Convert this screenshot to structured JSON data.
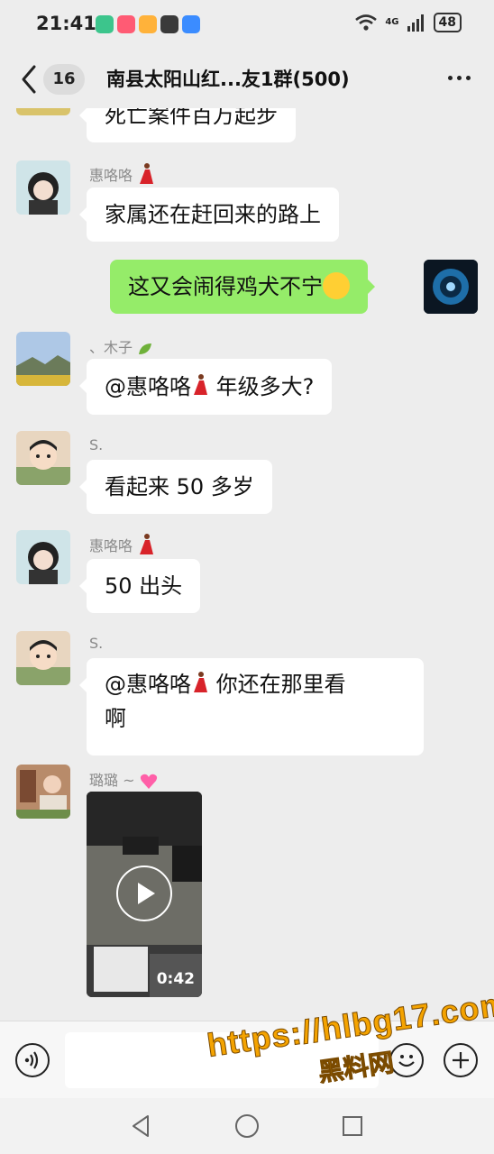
{
  "status_bar": {
    "time": "21:41",
    "network": "4G",
    "battery": "48"
  },
  "header": {
    "unread_count": "16",
    "title": "南县太阳山红...友1群(500)"
  },
  "messages": [
    {
      "text": "死亡案件百万起步"
    },
    {
      "sender": "惠咯咯",
      "text": "家属还在赶回来的路上"
    },
    {
      "text": "这又会闹得鸡犬不宁"
    },
    {
      "sender": "、木子",
      "text_prefix": "@惠咯咯",
      "text": " 年级多大?"
    },
    {
      "sender": "S.",
      "text": "看起来 50 多岁"
    },
    {
      "sender": "惠咯咯",
      "text": "50 出头"
    },
    {
      "sender": "S.",
      "text_prefix": "@惠咯咯",
      "text_line1": " 你还在那里看",
      "text_line2": "啊"
    },
    {
      "sender": "璐璐 ~",
      "video_duration": "0:42"
    }
  ],
  "input": {
    "placeholder": ""
  },
  "watermark": {
    "url": "https://hlbg17.com",
    "name": "黑料网"
  },
  "colors": {
    "background": "#ededed",
    "self_bubble": "#95ec69",
    "other_bubble": "#ffffff"
  },
  "icons": [
    "back-arrow-icon",
    "voice-icon",
    "emoji-icon",
    "plus-icon",
    "play-icon",
    "more-icon"
  ]
}
